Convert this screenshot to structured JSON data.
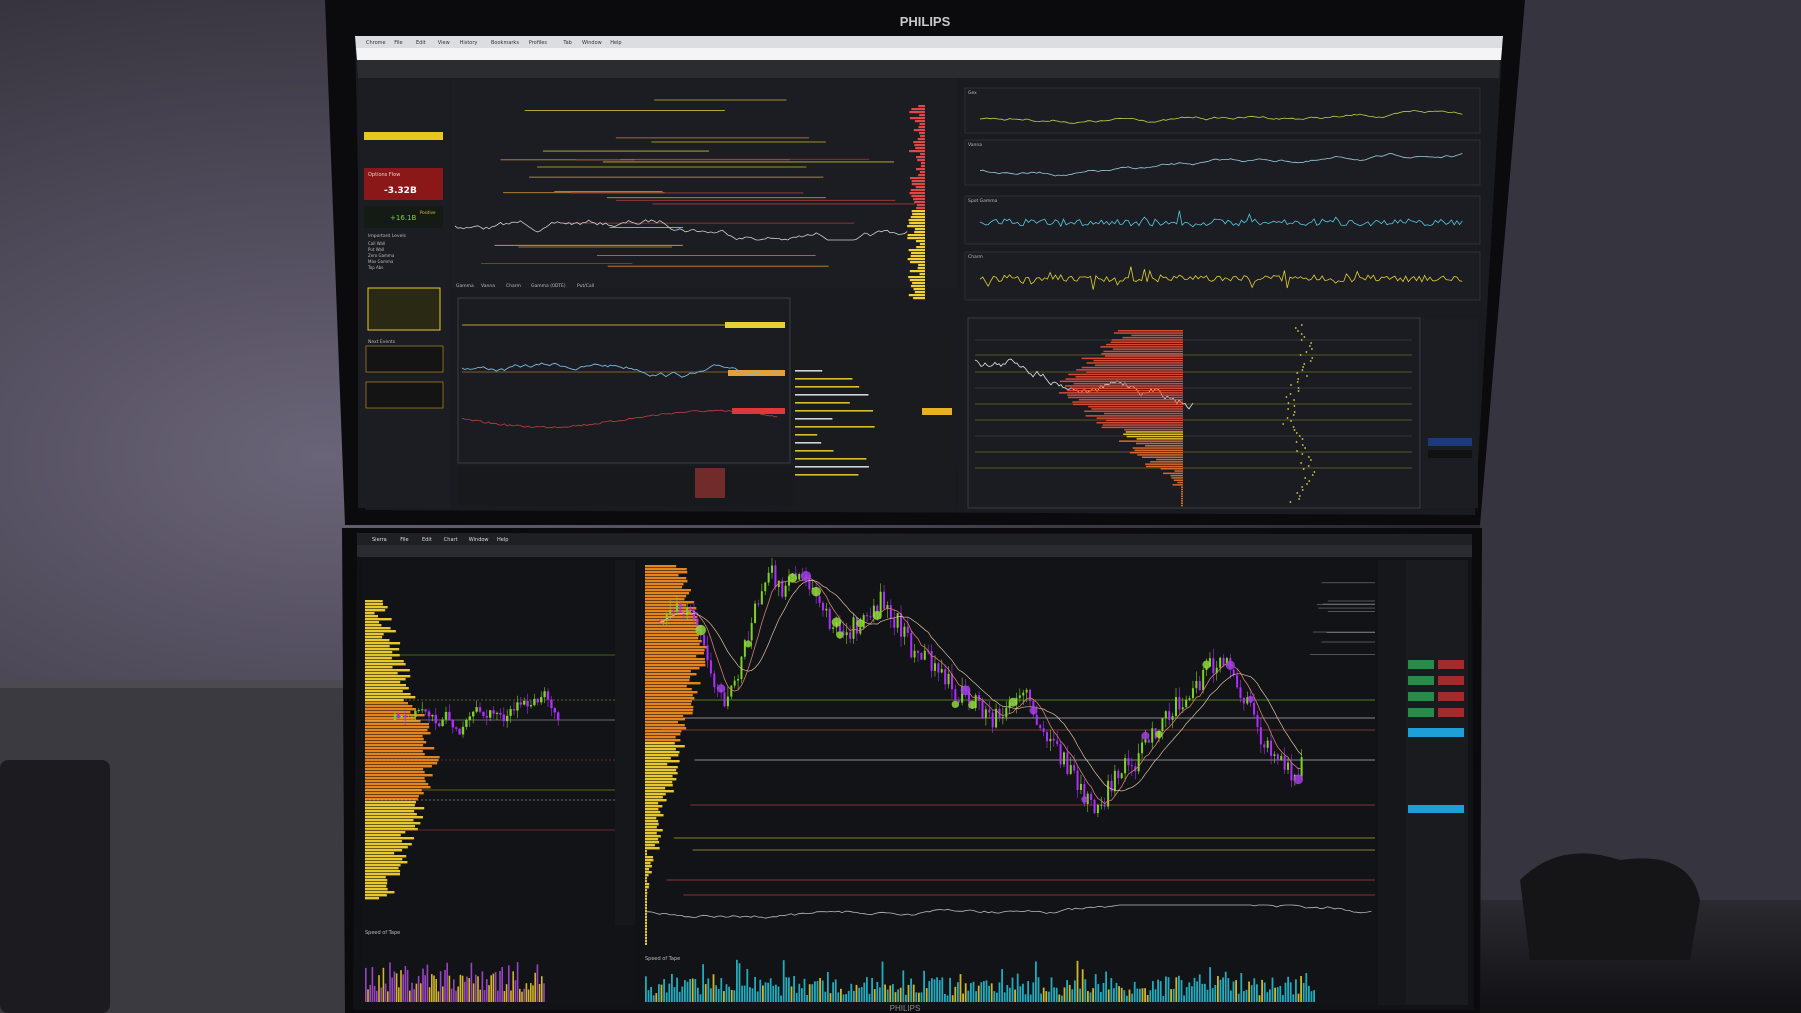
{
  "top_monitor": {
    "brand": "PHILIPS",
    "menubar": [
      "Chrome",
      "File",
      "Edit",
      "View",
      "History",
      "Bookmarks",
      "Profiles",
      "Tab",
      "Window",
      "Help"
    ],
    "sidebar": {
      "options_flow_label": "Options Flow",
      "options_flow_value": "-3.32B",
      "delta_value": "+16.1B",
      "delta_tag": "Positive",
      "important_levels_title": "Important Levels",
      "level_names": [
        "Call Wall",
        "Put Wall",
        "Zero Gamma",
        "Max Gamma",
        "Top Abs"
      ],
      "next_events_title": "Next Events"
    },
    "chart_tabs": [
      "Gamma",
      "Vanna",
      "Charm",
      "Gamma (0DTE)",
      "Put/Call"
    ],
    "panel_titles": [
      "Gex",
      "Vanna",
      "Spot Gamma",
      "Charm"
    ]
  },
  "bottom_monitor": {
    "brand": "PHILIPS",
    "menubar": [
      "Sierra",
      "File",
      "Edit",
      "Chart",
      "Window",
      "Help"
    ],
    "bottom_left_label": "Speed of Tape",
    "bottom_right_label": "Speed of Tape"
  },
  "colors": {
    "chart_bg": "#121317",
    "grid": "#2a2c34",
    "price_line": "#e8e8e8",
    "candle_up": "#7ed321",
    "candle_down": "#b02cff",
    "volume_profile": "#f08a1c",
    "level_yellow": "#f0e040",
    "level_red": "#e04848",
    "histo_cyan": "#26c6da",
    "histo_yellow": "#f2d22e"
  }
}
